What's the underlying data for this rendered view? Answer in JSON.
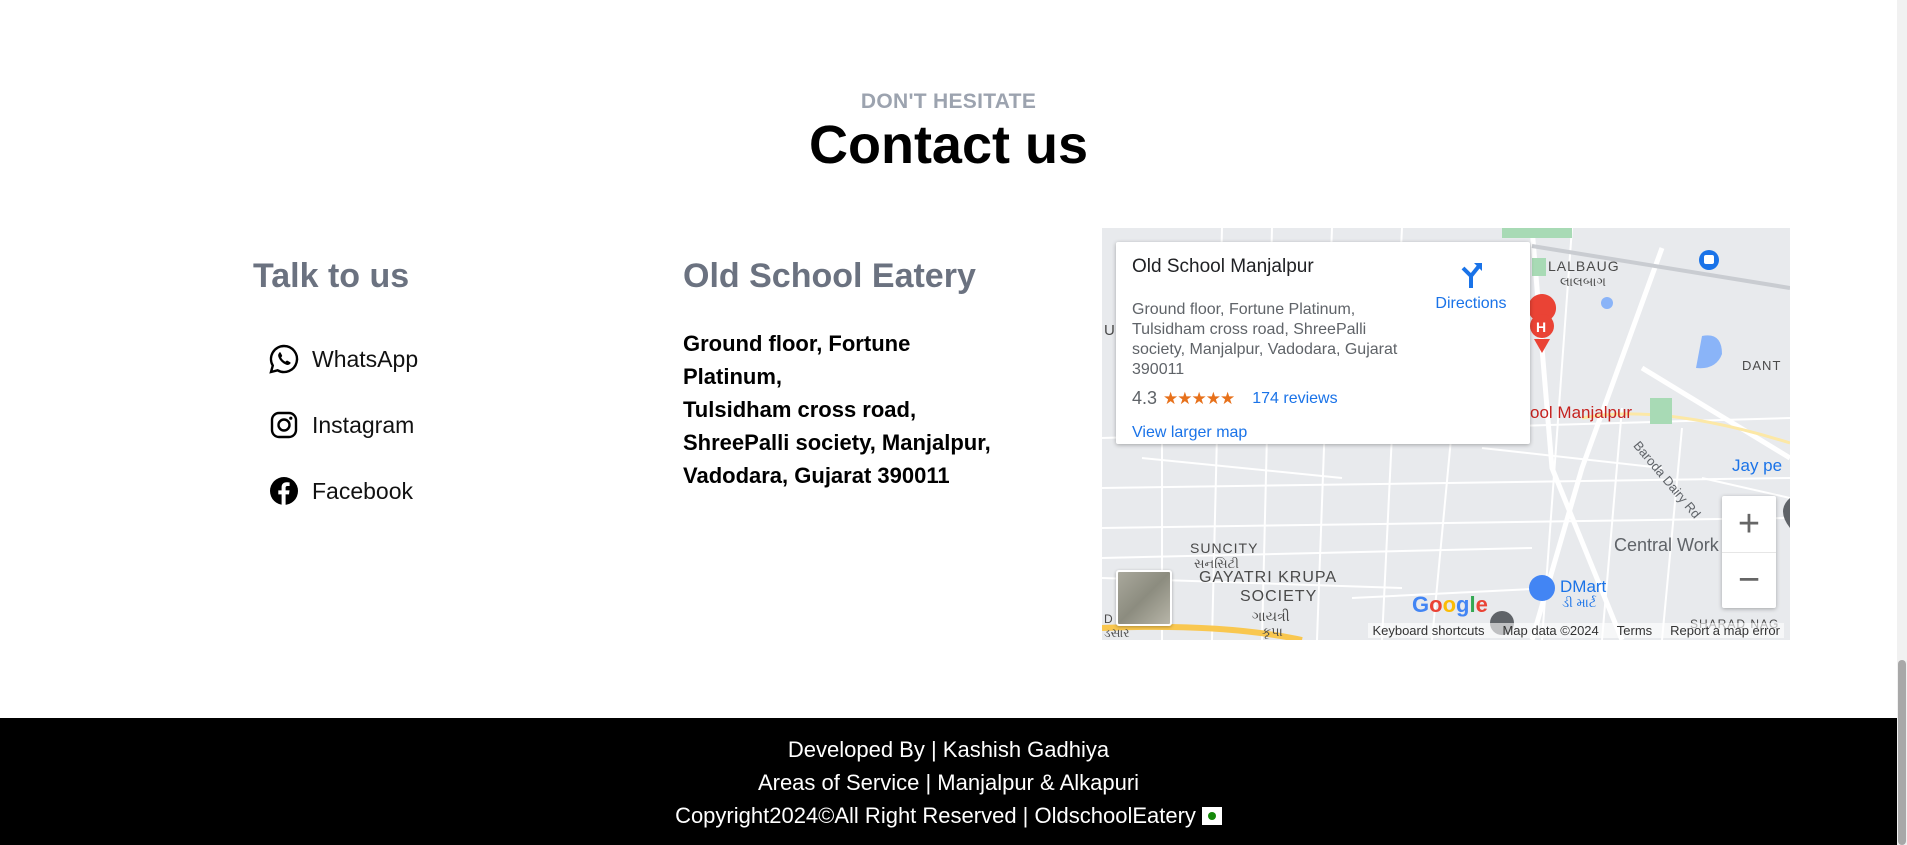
{
  "header": {
    "eyebrow": "DON'T HESITATE",
    "title": "Contact us"
  },
  "talk": {
    "heading": "Talk to us",
    "links": [
      {
        "label": "WhatsApp",
        "icon": "whatsapp-icon"
      },
      {
        "label": "Instagram",
        "icon": "instagram-icon"
      },
      {
        "label": "Facebook",
        "icon": "facebook-icon"
      }
    ]
  },
  "eatery": {
    "heading": "Old School Eatery",
    "address_lines": [
      "Ground floor, Fortune Platinum,",
      "Tulsidham cross road,",
      "ShreePalli society, Manjalpur,",
      "Vadodara, Gujarat 390011"
    ]
  },
  "map": {
    "place_name": "Old School Manjalpur",
    "address": "Ground floor, Fortune Platinum, Tulsidham cross road, ShreePalli society, Manjalpur, Vadodara, Gujarat 390011",
    "rating": "4.3",
    "stars": "★★★★★",
    "reviews": "174 reviews",
    "view_larger": "View larger map",
    "directions": "Directions",
    "zoom_in": "+",
    "zoom_out": "−",
    "google_logo": "Google",
    "attribution": [
      "Keyboard shortcuts",
      "Map data ©2024",
      "Terms",
      "Report a map error"
    ],
    "labels": {
      "lalbaug": "LALBAUG",
      "lalbaug_gu": "લાલબાગ",
      "place_marker": "ool Manjalpur",
      "baroda_dairy": "Baroda Dairy Rd",
      "jay": "Jay pe",
      "central": "Central Work",
      "suncity": "SUNCITY",
      "suncity_gu": "સનસિટી",
      "gayatri1": "GAYATRI KRUPA",
      "gayatri2": "SOCIETY",
      "gayatri_gu": "ગાયત્રી",
      "krupa_gu": "કૃપા",
      "dmart": "DMart",
      "dmart_gu": "ડી માર્ટ",
      "dant": "DANT",
      "sharad": "SHARAD NAG",
      "u_edge": "U",
      "d_edge": "D",
      "sar_edge": "ડસાર"
    },
    "accent_color": "#1a73e8",
    "marker_color": "#c5221f"
  },
  "footer": {
    "developed": "Developed By | Kashish Gadhiya",
    "areas": "Areas of Service | Manjalpur & Alkapuri",
    "copyright": "Copyright2024©All Right Reserved |  OldschoolEatery"
  }
}
